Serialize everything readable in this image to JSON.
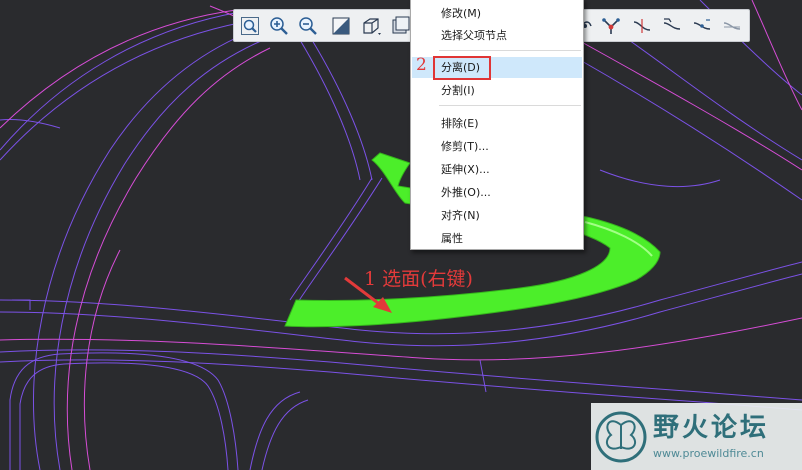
{
  "canvas": {
    "background": "#2a2b2e",
    "surface_color": "#4cee2a",
    "edge_color": "#7b52e6",
    "pink_line_color": "#d64dd6"
  },
  "toolbar": {
    "buttons": [
      {
        "icon": "zoom-fit-icon"
      },
      {
        "icon": "zoom-in-icon"
      },
      {
        "icon": "zoom-out-icon"
      },
      {
        "icon": "reorient-icon"
      },
      {
        "icon": "display-style-icon"
      },
      {
        "icon": "saved-views-icon"
      },
      {
        "icon": "surface-connect-icon"
      },
      {
        "icon": "curve-node-icon"
      },
      {
        "icon": "curve-edit-icon"
      },
      {
        "icon": "curve-transition-icon"
      },
      {
        "icon": "curve-split-icon"
      },
      {
        "icon": "curve-trim-icon"
      }
    ]
  },
  "context_menu": {
    "items": [
      {
        "label": "修改(M)"
      },
      {
        "label": "选择父项节点"
      },
      {
        "label": "分离(D)",
        "highlighted": true
      },
      {
        "label": "分割(I)"
      },
      {
        "label": "排除(E)"
      },
      {
        "label": "修剪(T)..."
      },
      {
        "label": "延伸(X)..."
      },
      {
        "label": "外推(O)..."
      },
      {
        "label": "对齐(N)"
      },
      {
        "label": "属性"
      }
    ]
  },
  "annotations": {
    "step1": "1 选面(右键)",
    "step2": "2",
    "color": "#e23a3a"
  },
  "watermark": {
    "title": "野火论坛",
    "url": "www.proewildfire.cn"
  }
}
